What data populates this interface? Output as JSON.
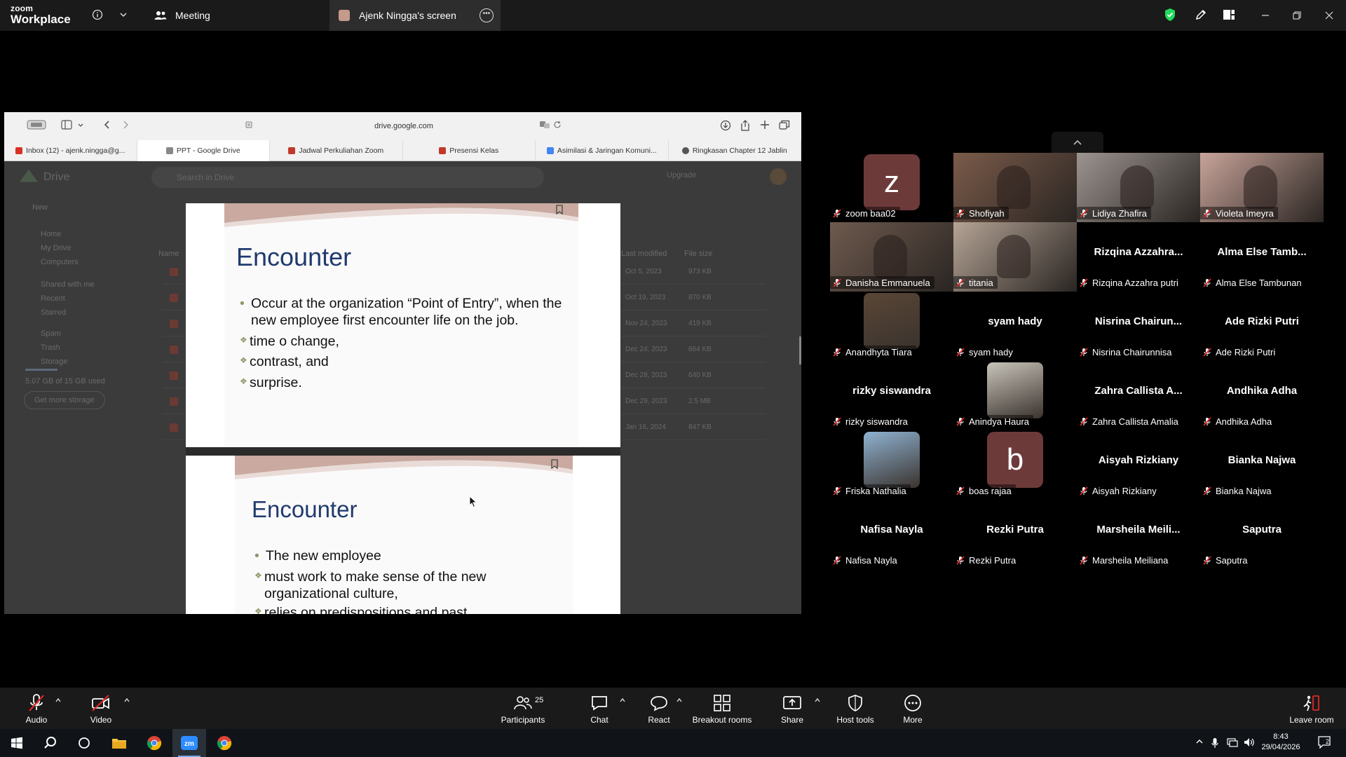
{
  "app": {
    "brand_top": "zoom",
    "brand_bottom": "Workplace"
  },
  "tabs": [
    {
      "label": "Meeting"
    },
    {
      "label": "Ajenk Ningga's screen"
    }
  ],
  "browser": {
    "url": "drive.google.com",
    "tabs": [
      {
        "label": "Inbox (12) - ajenk.ningga@g...",
        "color": "#d93025"
      },
      {
        "label": "PPT - Google Drive",
        "color": "#888888"
      },
      {
        "label": "Jadwal Perkuliahan Zoom",
        "color": "#c0392b"
      },
      {
        "label": "Presensi Kelas",
        "color": "#c0392b"
      },
      {
        "label": "Asimilasi & Jaringan Komuni...",
        "color": "#4285f4"
      },
      {
        "label": "Ringkasan Chapter 12 Jablin",
        "color": "#555555"
      }
    ]
  },
  "drive": {
    "title": "Drive",
    "search_placeholder": "Search in Drive",
    "nav": [
      "New",
      "Home",
      "My Drive",
      "Computers",
      "Shared with me",
      "Recent",
      "Starred",
      "Spam",
      "Trash",
      "Storage"
    ],
    "storage": "5.07 GB of 15 GB used",
    "storage_button": "Get more storage",
    "upgrade": "Upgrade",
    "col_name": "Name",
    "col_modified": "Last modified",
    "col_size": "File size",
    "rows": [
      {
        "modified": "Oct 5, 2023",
        "size": "973 KB"
      },
      {
        "modified": "Oct 19, 2023",
        "size": "870 KB"
      },
      {
        "modified": "Nov 24, 2023",
        "size": "419 KB"
      },
      {
        "modified": "Dec 24, 2023",
        "size": "664 KB"
      },
      {
        "modified": "Dec 28, 2023",
        "size": "640 KB"
      },
      {
        "modified": "Dec 29, 2023",
        "size": "2.5 MB"
      },
      {
        "modified": "Jan 16, 2024",
        "size": "847 KB"
      }
    ]
  },
  "slides": [
    {
      "title": "Encounter",
      "bullets": [
        {
          "text": "Occur at the organization “Point of Entry”, when the new employee first encounter life on the job.",
          "sub": [
            "time o change,",
            "contrast, and",
            "surprise."
          ]
        }
      ]
    },
    {
      "title": "Encounter",
      "bullets": [
        {
          "text": "The new employee",
          "sub": [
            "must work to make sense of the new organizational culture,",
            "relies on predispositions and past"
          ]
        }
      ]
    }
  ],
  "participants": [
    {
      "name": "zoom baa02",
      "kind": "letter",
      "letter": "z",
      "color": "#6d3a3a"
    },
    {
      "name": "Shofiyah",
      "kind": "video",
      "color": "#7b5b4a"
    },
    {
      "name": "Lidiya Zhafira",
      "kind": "video",
      "color": "#9c9490"
    },
    {
      "name": "Violeta Imeyra",
      "kind": "video",
      "color": "#c8a49a"
    },
    {
      "name": "Danisha Emmanuela",
      "kind": "video",
      "color": "#6e5a4e"
    },
    {
      "name": "titania",
      "kind": "video",
      "color": "#b5a496"
    },
    {
      "name": "Rizqina Azzahra putri",
      "kind": "text",
      "big": "Rizqina  Azzahra..."
    },
    {
      "name": "Alma Else Tambunan",
      "kind": "text",
      "big": "Alma Else Tamb..."
    },
    {
      "name": "Anandhyta Tiara",
      "kind": "photo",
      "color": "#5a4636"
    },
    {
      "name": "syam hady",
      "kind": "text",
      "big": "syam hady"
    },
    {
      "name": "Nisrina Chairunnisa",
      "kind": "text",
      "big": "Nisrina  Chairun..."
    },
    {
      "name": "Ade Rizki Putri",
      "kind": "text",
      "big": "Ade Rizki Putri"
    },
    {
      "name": "rizky siswandra",
      "kind": "text",
      "big": "rizky siswandra"
    },
    {
      "name": "Anindya Haura",
      "kind": "photo",
      "color": "#c9c4bb"
    },
    {
      "name": "Zahra Callista Amalia",
      "kind": "text",
      "big": "Zahra Callista A..."
    },
    {
      "name": "Andhika Adha",
      "kind": "text",
      "big": "Andhika Adha"
    },
    {
      "name": "Friska Nathalia",
      "kind": "photo",
      "color": "#8fb2d1"
    },
    {
      "name": "boas rajaa",
      "kind": "letter",
      "letter": "b",
      "color": "#6d3a3a"
    },
    {
      "name": "Aisyah Rizkiany",
      "kind": "text",
      "big": "Aisyah Rizkiany"
    },
    {
      "name": "Bianka Najwa",
      "kind": "text",
      "big": "Bianka Najwa"
    },
    {
      "name": "Nafisa Nayla",
      "kind": "text",
      "big": "Nafisa Nayla"
    },
    {
      "name": "Rezki Putra",
      "kind": "text",
      "big": "Rezki Putra"
    },
    {
      "name": "Marsheila Meiliana",
      "kind": "text",
      "big": "Marsheila  Meili..."
    },
    {
      "name": "Saputra",
      "kind": "text",
      "big": "Saputra"
    }
  ],
  "toolbar": {
    "audio": "Audio",
    "video": "Video",
    "participants": "Participants",
    "participants_count": "25",
    "chat": "Chat",
    "react": "React",
    "breakout": "Breakout rooms",
    "share": "Share",
    "host_tools": "Host tools",
    "more": "More",
    "leave": "Leave room"
  },
  "taskbar": {
    "time": "8:43",
    "date": "29/04/2026",
    "notifications": "2"
  },
  "colors": {
    "accent_green": "#23d95c",
    "muted_red": "#e02828",
    "slide_title": "#1f3a6e"
  }
}
